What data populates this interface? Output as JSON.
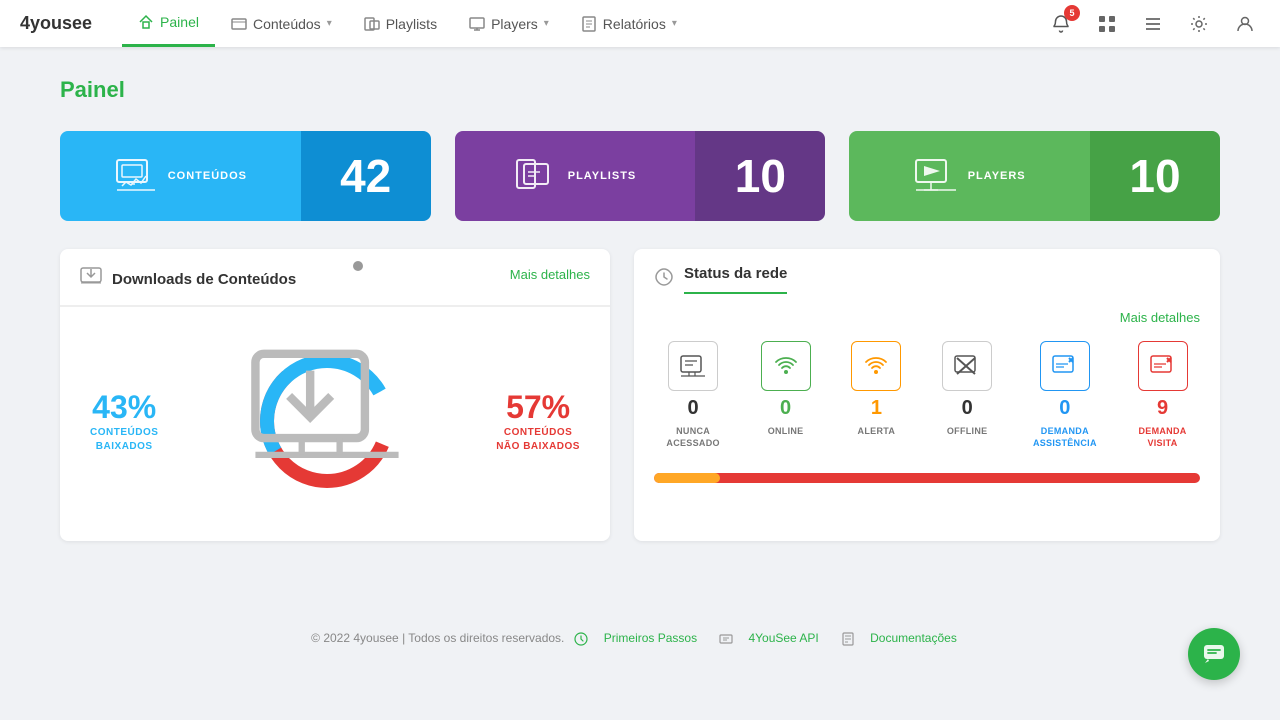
{
  "brand": {
    "name": "4yousee"
  },
  "nav": {
    "items": [
      {
        "id": "painel",
        "label": "Painel",
        "active": true,
        "hasDropdown": false
      },
      {
        "id": "conteudos",
        "label": "Conteúdos",
        "active": false,
        "hasDropdown": true
      },
      {
        "id": "playlists",
        "label": "Playlists",
        "active": false,
        "hasDropdown": false
      },
      {
        "id": "players",
        "label": "Players",
        "active": false,
        "hasDropdown": true
      },
      {
        "id": "relatorios",
        "label": "Relatórios",
        "active": false,
        "hasDropdown": true
      }
    ],
    "badge_count": "5"
  },
  "page": {
    "title": "Painel"
  },
  "stat_cards": [
    {
      "id": "conteudos",
      "label": "CONTEÚDOS",
      "value": "42",
      "color_left": "blue",
      "color_right": "blue-dark"
    },
    {
      "id": "playlists",
      "label": "PLAYLISTS",
      "value": "10",
      "color_left": "purple",
      "color_right": "purple-dark"
    },
    {
      "id": "players",
      "label": "PLAYERS",
      "value": "10",
      "color_left": "green",
      "color_right": "green-dark"
    }
  ],
  "downloads_panel": {
    "title": "Downloads de Conteúdos",
    "more_details": "Mais detalhes",
    "percent_baixados": "43%",
    "label_baixados_line1": "CONTEÚDOS",
    "label_baixados_line2": "BAIXADOS",
    "percent_nao_baixados": "57%",
    "label_nao_baixados_line1": "CONTEÚDOS",
    "label_nao_baixados_line2": "NÃO BAIXADOS",
    "donut_blue_percent": 43,
    "donut_red_percent": 57
  },
  "status_panel": {
    "title": "Status da rede",
    "more_details": "Mais detalhes",
    "items": [
      {
        "id": "nunca",
        "count": "0",
        "label_line1": "NUNCA",
        "label_line2": "ACESSADO",
        "color": "default",
        "border": "default"
      },
      {
        "id": "online",
        "count": "0",
        "label_line1": "ONLINE",
        "label_line2": "",
        "color": "green",
        "border": "green"
      },
      {
        "id": "alerta",
        "count": "1",
        "label_line1": "ALERTA",
        "label_line2": "",
        "color": "orange",
        "border": "orange"
      },
      {
        "id": "offline",
        "count": "0",
        "label_line1": "OFFLINE",
        "label_line2": "",
        "color": "default",
        "border": "default"
      },
      {
        "id": "demanda-assistencia",
        "count": "0",
        "label_line1": "DEMANDA",
        "label_line2": "ASSISTÊNCIA",
        "color": "blue",
        "border": "blue"
      },
      {
        "id": "demanda-visita",
        "count": "9",
        "label_line1": "DEMANDA",
        "label_line2": "VISITA",
        "color": "red",
        "border": "red"
      }
    ],
    "progress_fill_percent": 12
  },
  "footer": {
    "copyright": "© 2022 4yousee | Todos os direitos reservados.",
    "links": [
      {
        "label": "Primeiros Passos"
      },
      {
        "label": "4YouSee API"
      },
      {
        "label": "Documentações"
      }
    ]
  }
}
